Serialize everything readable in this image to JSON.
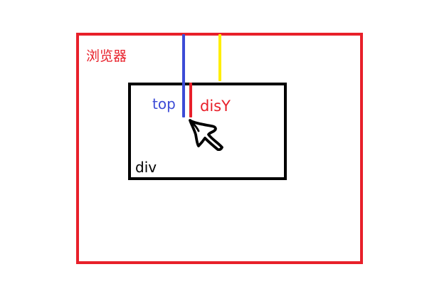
{
  "diagram": {
    "browser_label": "浏览器",
    "div_label": "div",
    "top_label": "top",
    "disY_label": "disY"
  },
  "colors": {
    "browser_border": "#e8202a",
    "div_border": "#000000",
    "top_line": "#3c4bd6",
    "disY_line": "#e8202a",
    "offset_line": "#ffee00",
    "cursor": "#000000"
  },
  "icons": {
    "pointer": "mouse-cursor-icon"
  }
}
